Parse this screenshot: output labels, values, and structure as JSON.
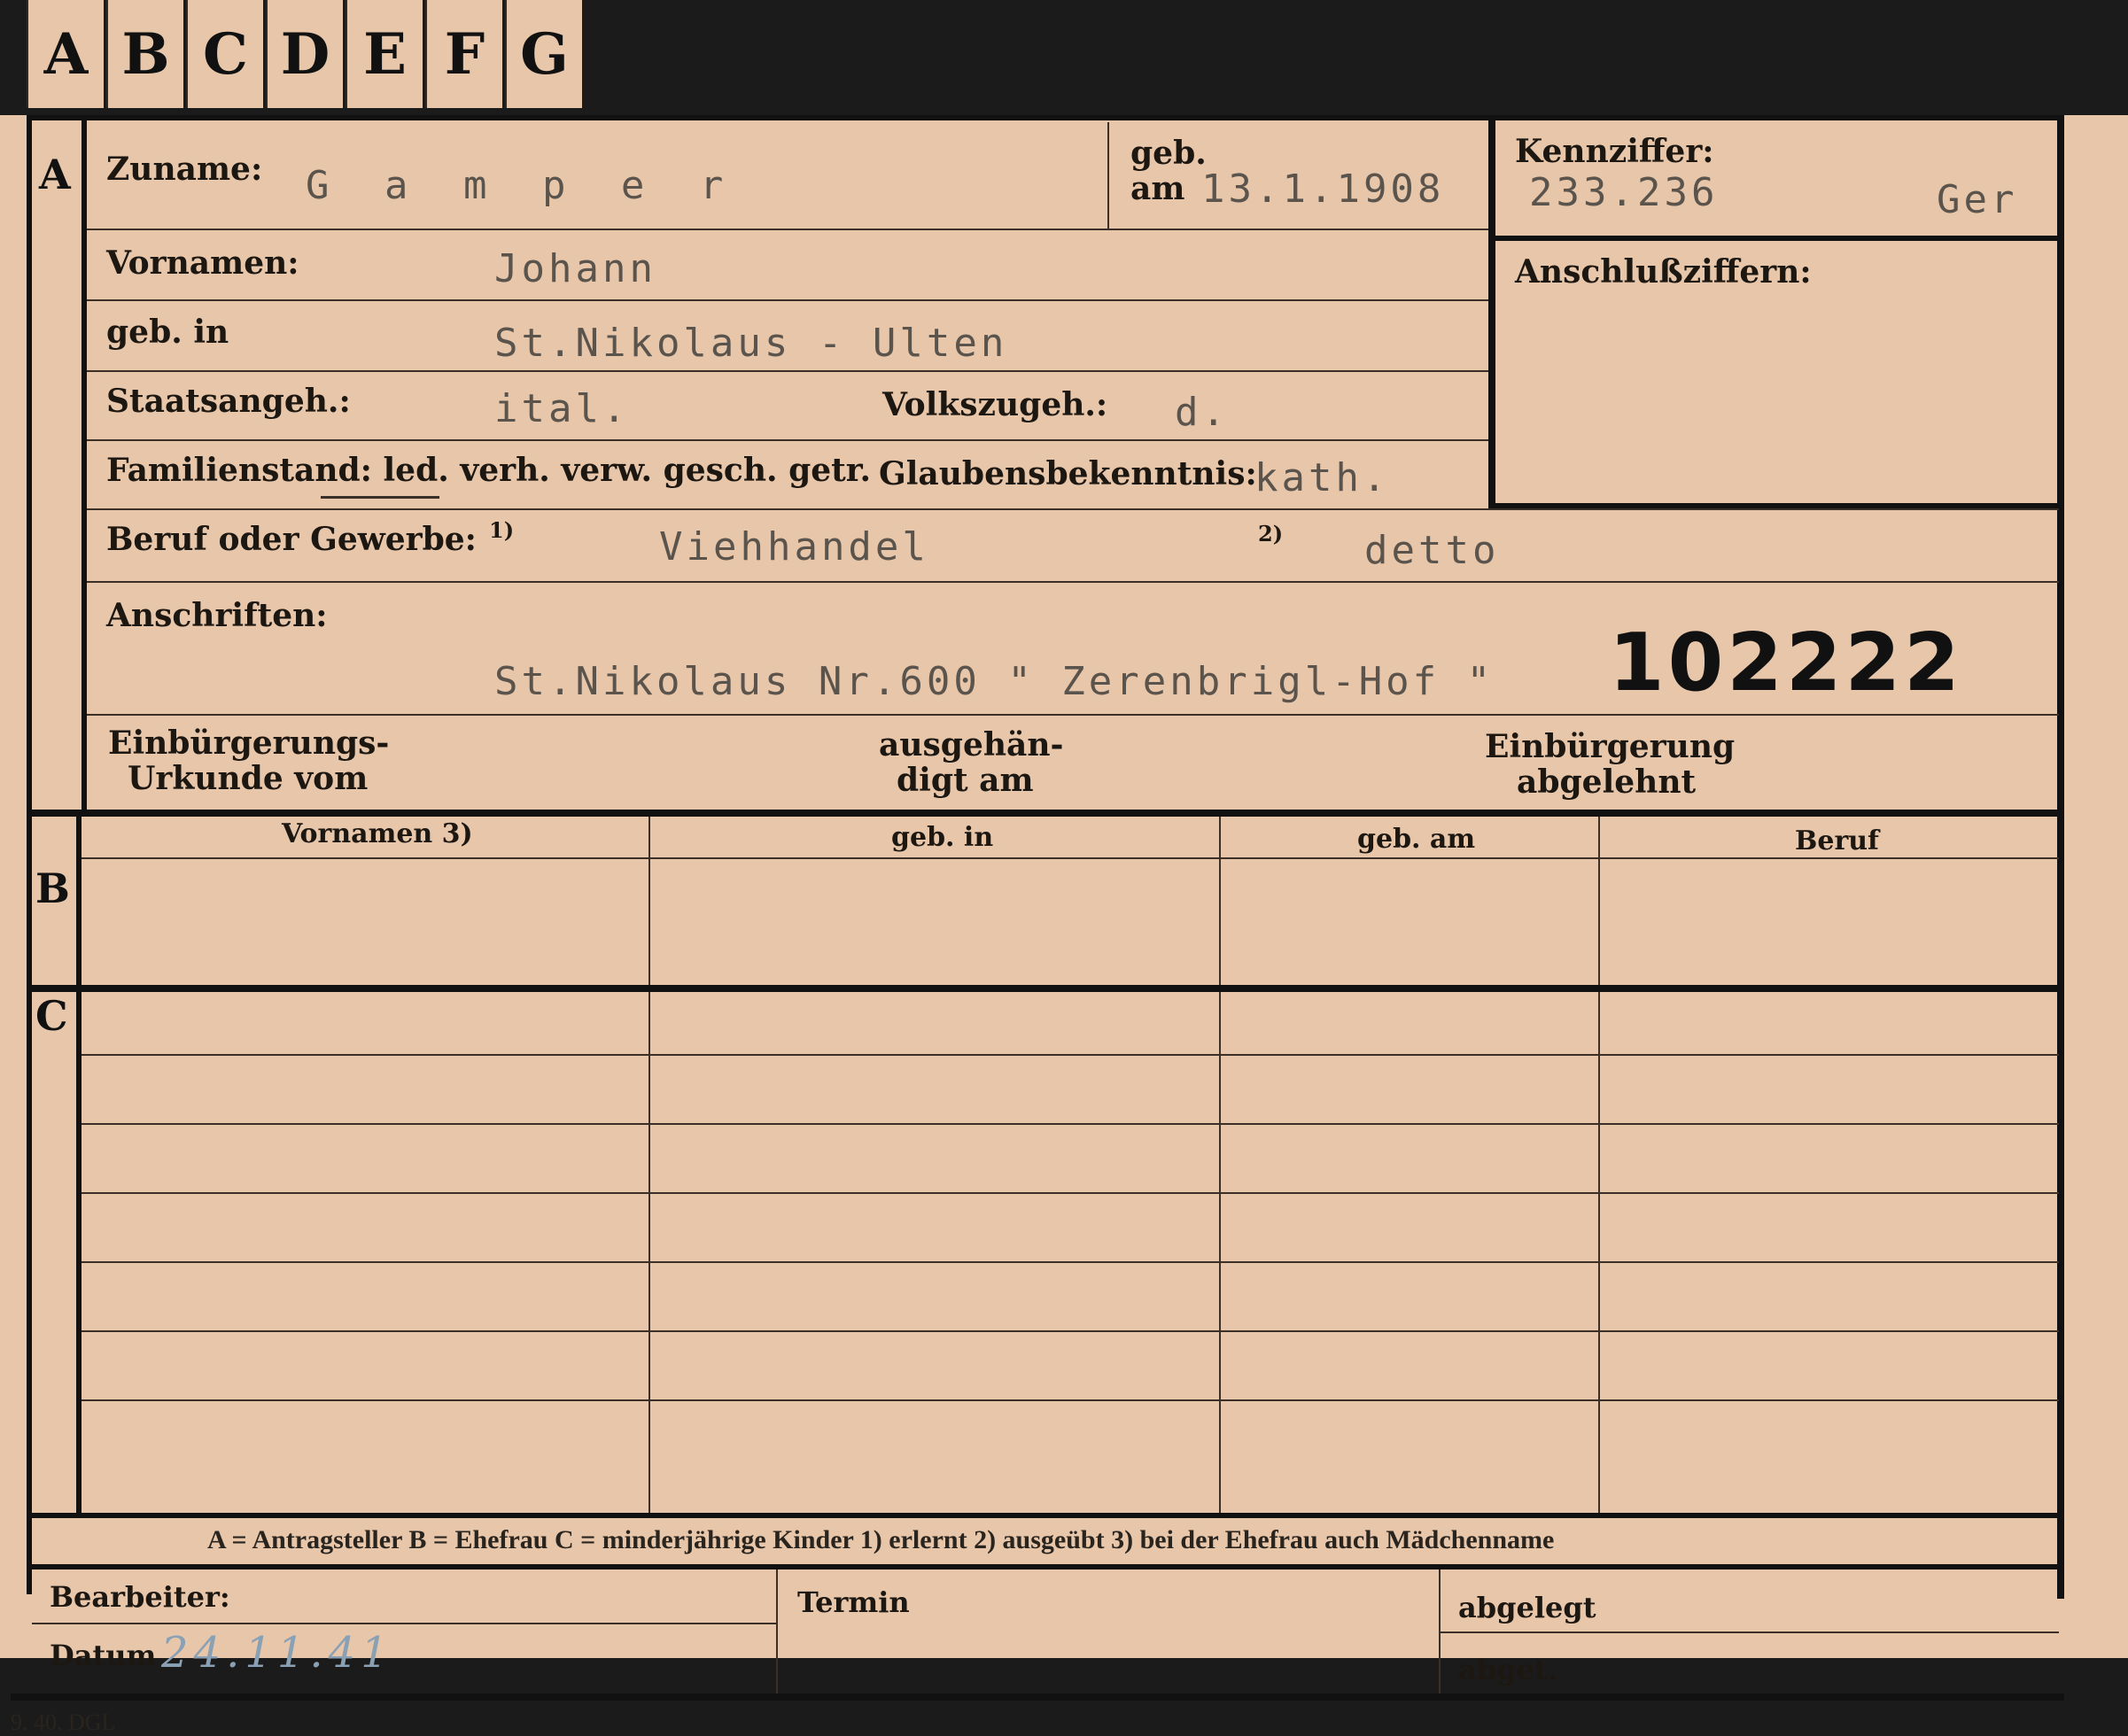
{
  "tabs": [
    "A",
    "B",
    "C",
    "D",
    "E",
    "F",
    "G"
  ],
  "sections": {
    "a": "A",
    "b": "B",
    "c": "C"
  },
  "fields": {
    "zuname_label": "Zuname:",
    "zuname_value": "G a m p e r",
    "geb_label": "geb.",
    "geb_am_label": "am",
    "geb_am_value": "13.1.1908",
    "kennziffer_label": "Kennziffer:",
    "kennziffer_value": "233.236",
    "kennziffer_suffix": "Ger",
    "vornamen_label": "Vornamen:",
    "vornamen_value": "Johann",
    "anschluss_label": "Anschlußziffern:",
    "gebin_label": "geb. in",
    "gebin_value": "St.Nikolaus - Ulten",
    "staats_label": "Staatsangeh.:",
    "staats_value": "ital.",
    "volks_label": "Volkszugeh.:",
    "volks_value": "d.",
    "familien_label": "Familienstand: led. verh. verw. gesch. getr.",
    "glaubens_label": "Glaubensbekenntnis:",
    "glaubens_value": "kath.",
    "beruf_label": "Beruf oder Gewerbe:",
    "beruf_note1": "1)",
    "beruf_value1": "Viehhandel",
    "beruf_note2": "2)",
    "beruf_value2": "detto",
    "anschriften_label": "Anschriften:",
    "anschriften_value": "St.Nikolaus Nr.600 \" Zerenbrigl-Hof \"",
    "card_number": "102222",
    "einb_urkunde_label_1": "Einbürgerungs-",
    "einb_urkunde_label_2": "Urkunde vom",
    "ausgehaend_label_1": "ausgehän-",
    "ausgehaend_label_2": "digt am",
    "einb_abgelehnt_label_1": "Einbürgerung",
    "einb_abgelehnt_label_2": "abgelehnt"
  },
  "table_headers": [
    "Vornamen 3)",
    "geb. in",
    "geb. am",
    "Beruf"
  ],
  "legend": "A = Antragsteller   B = Ehefrau   C = minderjährige Kinder   1) erlernt   2) ausgeübt   3) bei der Ehefrau auch Mädchenname",
  "footer": {
    "bearbeiter_label": "Bearbeiter:",
    "datum_label": "Datum",
    "datum_value": "24.11.41",
    "termin_label": "Termin",
    "abgelegt_label": "abgelegt",
    "abget_label": "abget.",
    "print_code": "9. 40. DGL"
  }
}
